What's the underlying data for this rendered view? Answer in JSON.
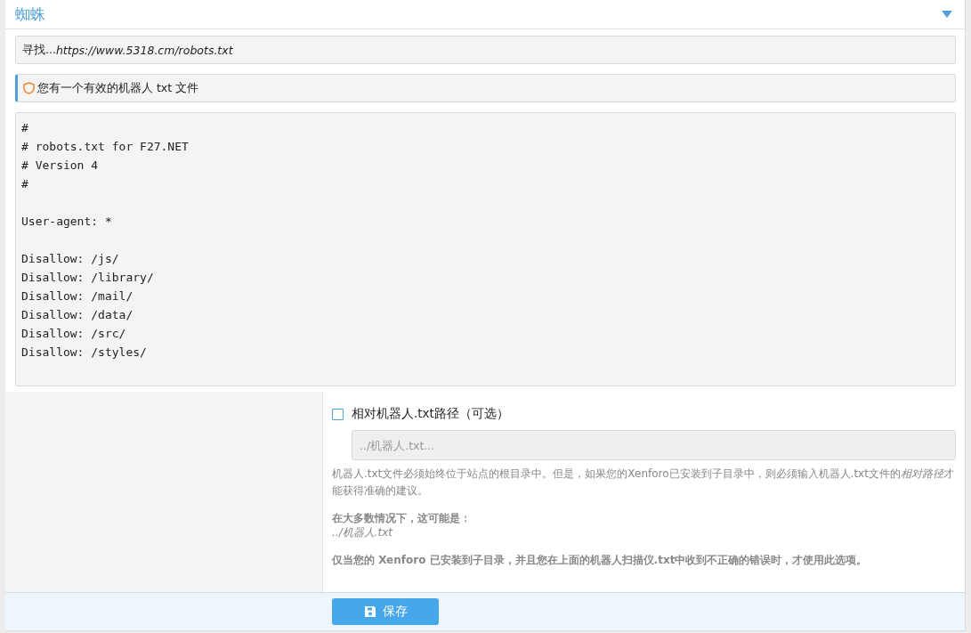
{
  "section": {
    "title": "蜘蛛",
    "expanded": true
  },
  "search_bar": {
    "prefix": "寻找...",
    "url": "https://www.5318.cm/robots.txt"
  },
  "notice": {
    "text": "您有一个有效的机器人 txt 文件"
  },
  "robots_file": {
    "content": "#\n# robots.txt for F27.NET\n# Version 4\n#\n\nUser-agent: *\n\nDisallow: /js/\nDisallow: /library/\nDisallow: /mail/\nDisallow: /data/\nDisallow: /src/\nDisallow: /styles/"
  },
  "option": {
    "label": "相对机器人.txt路径（可选）",
    "checked": false,
    "placeholder": "../机器人.txt...",
    "explanation": {
      "before": "机器人.txt文件必须始终位于站点的根目录中。但是，如果您的Xenforo已安装到子目录中，则必须输入机器人.txt文件的",
      "emphasis": "相对路径",
      "after": "才能获得准确的建议。"
    },
    "hint_title": "在大多数情况下，这可能是：",
    "hint_example": "../机器人.txt",
    "note": "仅当您的 Xenforo 已安装到子目录，并且您在上面的机器人扫描仪.txt中收到不正确的错误时，才使用此选项。"
  },
  "save_button": {
    "label": "保存"
  }
}
